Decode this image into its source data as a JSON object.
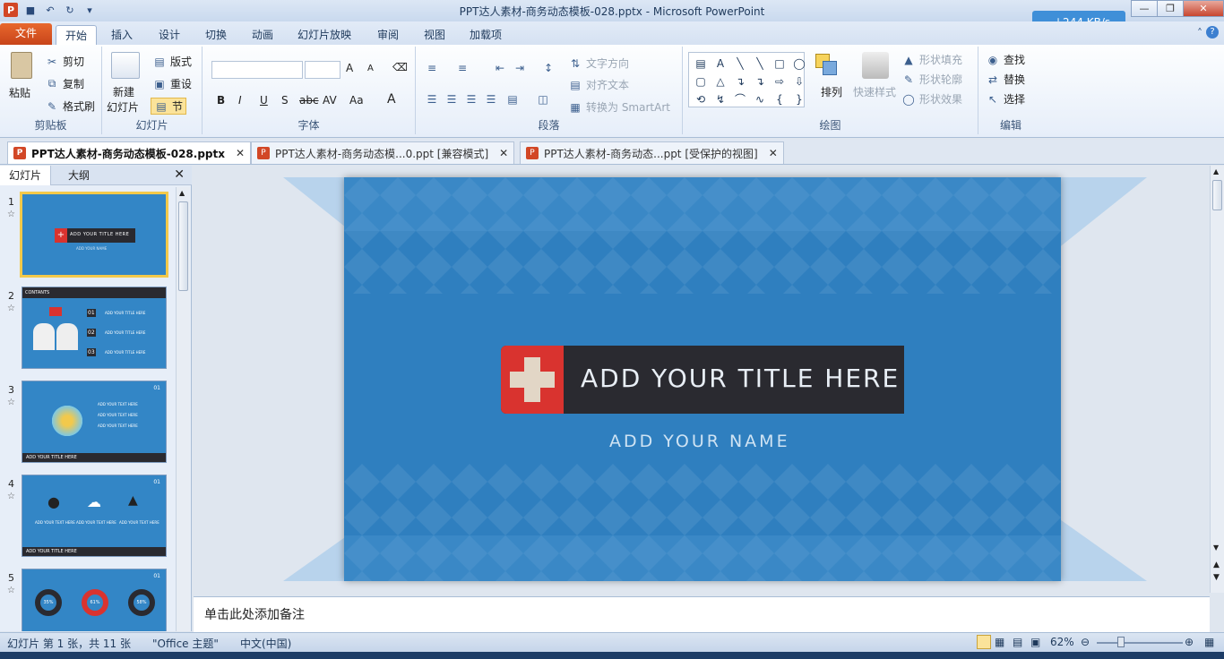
{
  "window": {
    "title": "PPT达人素材-商务动态模板-028.pptx - Microsoft PowerPoint"
  },
  "net_speed": "↓244 KB/s",
  "ribbon_tabs": [
    {
      "label": "文件"
    },
    {
      "label": "开始"
    },
    {
      "label": "插入"
    },
    {
      "label": "设计"
    },
    {
      "label": "切换"
    },
    {
      "label": "动画"
    },
    {
      "label": "幻灯片放映"
    },
    {
      "label": "审阅"
    },
    {
      "label": "视图"
    },
    {
      "label": "加载项"
    }
  ],
  "clipboard": {
    "paste": "粘贴",
    "cut": "剪切",
    "copy": "复制",
    "format": "格式刷",
    "label": "剪贴板"
  },
  "slides_group": {
    "new": "新建",
    "new2": "幻灯片",
    "layout": "版式",
    "reset": "重设",
    "section": "节",
    "label": "幻灯片"
  },
  "font_group": {
    "label": "字体",
    "bold": "B",
    "italic": "I",
    "underline": "U",
    "shadow": "S",
    "strike": "abc",
    "spacing": "AV",
    "case": "Aa",
    "grow": "A",
    "shrink": "A"
  },
  "paragraph": {
    "text_dir": "文字方向",
    "align_text": "对齐文本",
    "smartart": "转换为 SmartArt",
    "label": "段落"
  },
  "drawing": {
    "arrange": "排列",
    "quick_styles": "快速样式",
    "fill": "形状填充",
    "outline": "形状轮廓",
    "effects": "形状效果",
    "label": "绘图"
  },
  "editing": {
    "find": "查找",
    "replace": "替换",
    "select": "选择",
    "label": "编辑"
  },
  "doc_tabs": [
    {
      "label": "PPT达人素材-商务动态模板-028.pptx"
    },
    {
      "label": "PPT达人素材-商务动态模...0.ppt [兼容模式]"
    },
    {
      "label": "PPT达人素材-商务动态...ppt [受保护的视图]"
    }
  ],
  "panel_tabs": {
    "slides": "幻灯片",
    "outline": "大纲"
  },
  "thumbnails": [
    {
      "num": "1",
      "title": "ADD YOUR TITLE HERE",
      "sub": "ADD YOUR NAME"
    },
    {
      "num": "2",
      "title": "CONTANTS",
      "items": [
        "01",
        "02",
        "03"
      ],
      "item_text": "ADD YOUR TITLE HERE"
    },
    {
      "num": "3",
      "badge": "01",
      "footer": "ADD YOUR TITLE HERE",
      "line": "ADD YOUR TEXT HERE"
    },
    {
      "num": "4",
      "badge": "01",
      "footer": "ADD YOUR TITLE HERE",
      "line": "ADD YOUR TEXT HERE"
    },
    {
      "num": "5",
      "badge": "01",
      "rings": [
        "35%",
        "61%",
        "58%"
      ]
    }
  ],
  "slide": {
    "title": "ADD YOUR TITLE HERE",
    "subtitle": "ADD YOUR NAME"
  },
  "notes_placeholder": "单击此处添加备注",
  "status": {
    "slide_info": "幻灯片 第 1 张，共 11 张",
    "theme": "\"Office 主题\"",
    "lang": "中文(中国)",
    "zoom": "62%"
  },
  "colors": {
    "slide_bg": "#2f7fbf",
    "title_bar": "#2a2a30",
    "cross_red": "#d9332f",
    "cross": "#e2d6c6",
    "subtitle": "#cfe3f3"
  }
}
